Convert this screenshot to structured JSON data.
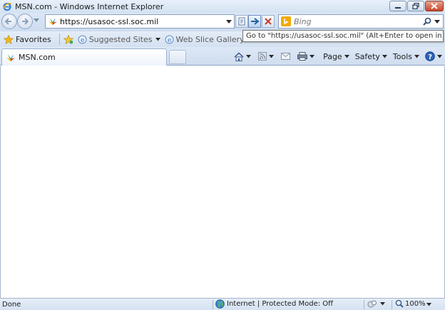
{
  "window": {
    "title": "MSN.com - Windows Internet Explorer",
    "controls": [
      "minimize-icon",
      "restore-icon",
      "close-icon"
    ]
  },
  "address_bar": {
    "url": "https://usasoc-ssl.soc.mil",
    "buttons": [
      "compatibility-view-icon",
      "go-arrow-icon",
      "stop-icon"
    ]
  },
  "search": {
    "placeholder": "Bing",
    "provider_icon": "bing-icon"
  },
  "favorites_bar": {
    "favorites_label": "Favorites",
    "items": [
      {
        "label": "Suggested Sites"
      },
      {
        "label": "Web Slice Gallery"
      }
    ]
  },
  "tooltip": {
    "text": "Go to \"https://usasoc-ssl.soc.mil\" (Alt+Enter to open in a new tab)"
  },
  "tabs": [
    {
      "title": "MSN.com",
      "active": true
    }
  ],
  "command_bar": {
    "items": [
      {
        "icon": "home-icon",
        "label": ""
      },
      {
        "icon": "feeds-icon",
        "label": ""
      },
      {
        "icon": "mail-icon",
        "label": ""
      },
      {
        "icon": "print-icon",
        "label": ""
      },
      {
        "label": "Page"
      },
      {
        "label": "Safety"
      },
      {
        "label": "Tools"
      },
      {
        "icon": "help-icon",
        "label": ""
      }
    ]
  },
  "status_bar": {
    "status": "Done",
    "zone": "Internet | Protected Mode: Off",
    "zoom": "100%"
  },
  "colors": {
    "chrome": "#d3e1f1",
    "close_button": "#c8452a",
    "border": "#8ea4c4"
  }
}
